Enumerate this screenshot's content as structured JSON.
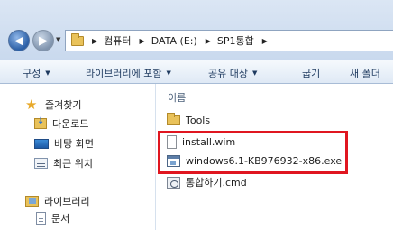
{
  "address_bar": {
    "crumbs": [
      "컴퓨터",
      "DATA (E:)",
      "SP1통합"
    ]
  },
  "toolbar": {
    "organize": "구성",
    "include_in_library": "라이브러리에 포함",
    "share_with": "공유 대상",
    "burn": "굽기",
    "new_folder": "새 폴더"
  },
  "nav_pane": {
    "favorites": "즐겨찾기",
    "downloads": "다운로드",
    "desktop": "바탕 화면",
    "recent": "최근 위치",
    "libraries": "라이브러리",
    "documents": "문서"
  },
  "content": {
    "column_name": "이름",
    "files": [
      {
        "name": "Tools",
        "icon": "folder-icon"
      },
      {
        "name": "install.wim",
        "icon": "file-icon"
      },
      {
        "name": "windows6.1-KB976932-x86.exe",
        "icon": "exe-icon"
      },
      {
        "name": "통합하기.cmd",
        "icon": "cmd-icon"
      }
    ]
  },
  "colors": {
    "highlight": "#e01620",
    "accent": "#2b5fa6"
  }
}
